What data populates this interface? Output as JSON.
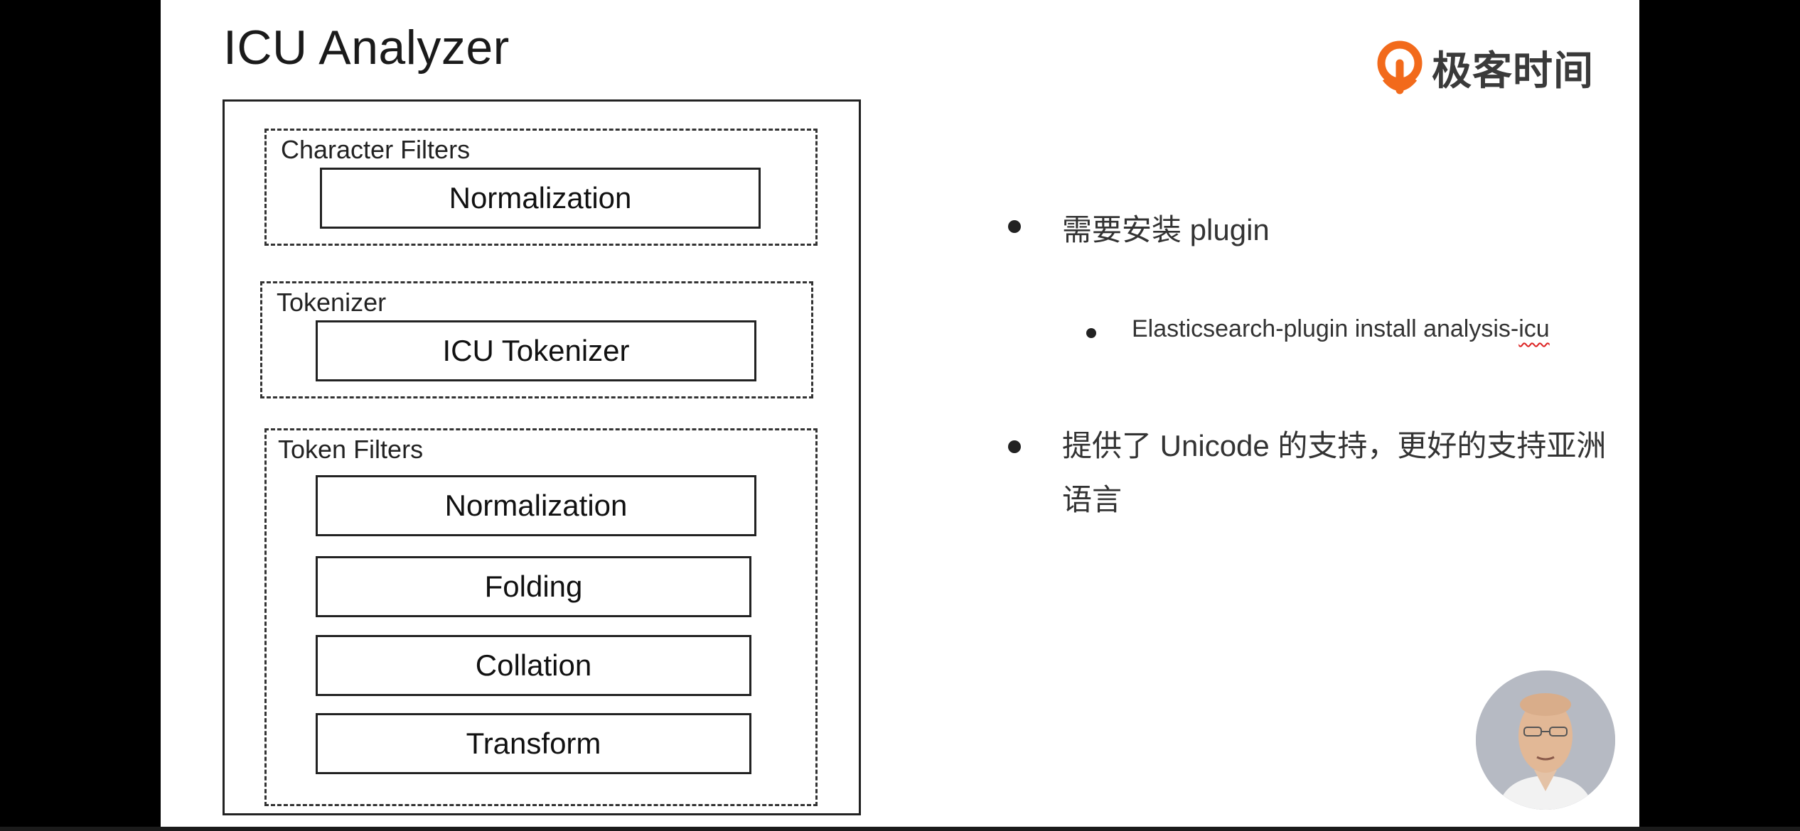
{
  "slide": {
    "title": "ICU Analyzer",
    "logo_text": "极客时间"
  },
  "diagram": {
    "character_filters": {
      "label": "Character Filters",
      "items": [
        "Normalization"
      ]
    },
    "tokenizer": {
      "label": "Tokenizer",
      "items": [
        "ICU Tokenizer"
      ]
    },
    "token_filters": {
      "label": "Token Filters",
      "items": [
        "Normalization",
        "Folding",
        "Collation",
        "Transform"
      ]
    }
  },
  "bullets": {
    "b1": "需要安装 plugin",
    "b2_prefix": "Elasticsearch-plugin install analysis-",
    "b2_suffix": "icu",
    "b3": "提供了 Unicode 的支持，更好的支持亚洲语言"
  },
  "colors": {
    "logo_orange": "#f26a1b",
    "background": "#000000",
    "slide": "#ffffff"
  },
  "icons": [
    "geektime-logo-icon",
    "presenter-avatar"
  ]
}
